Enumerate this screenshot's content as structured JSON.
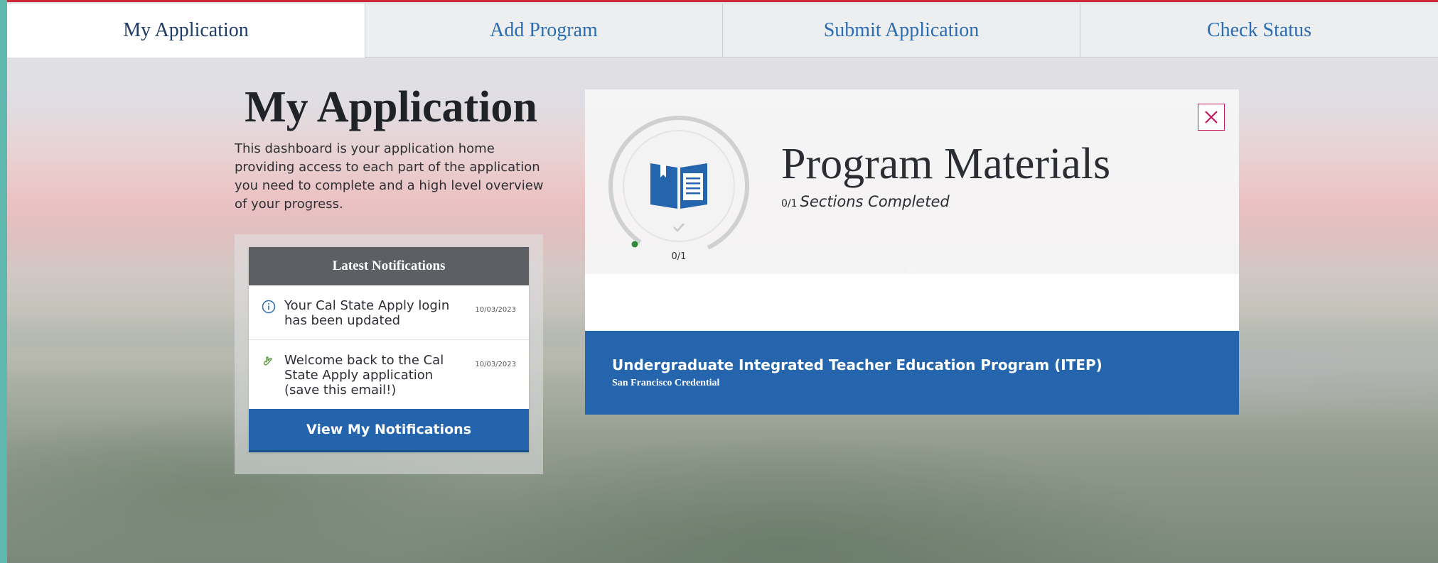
{
  "tabs": [
    {
      "label": "My Application",
      "active": true
    },
    {
      "label": "Add Program",
      "active": false
    },
    {
      "label": "Submit Application",
      "active": false
    },
    {
      "label": "Check Status",
      "active": false
    }
  ],
  "intro": {
    "title": "My Application",
    "description": "This dashboard is your application home providing access to each part of the application you need to complete and a high level overview of your progress."
  },
  "notifications": {
    "header": "Latest Notifications",
    "items": [
      {
        "icon": "info-icon",
        "text": "Your Cal State Apply login has been updated",
        "date": "10/03/2023"
      },
      {
        "icon": "wave-hand-icon",
        "text": "Welcome back to the Cal State Apply application (save this email!)",
        "date": "10/03/2023"
      }
    ],
    "button_label": "View My Notifications"
  },
  "program_materials": {
    "title": "Program Materials",
    "sections_count": "0/1",
    "sections_label": "Sections Completed",
    "ring_count": "0/1",
    "progress_fraction": 0,
    "icon": "book-icon",
    "close_icon": "close-icon",
    "program_name": "Undergraduate Integrated Teacher Education Program (ITEP)",
    "program_sub": "San Francisco Credential"
  },
  "colors": {
    "accent": "#2465ad",
    "header_gray": "#5c6065",
    "top_line": "#cc2a3a"
  }
}
